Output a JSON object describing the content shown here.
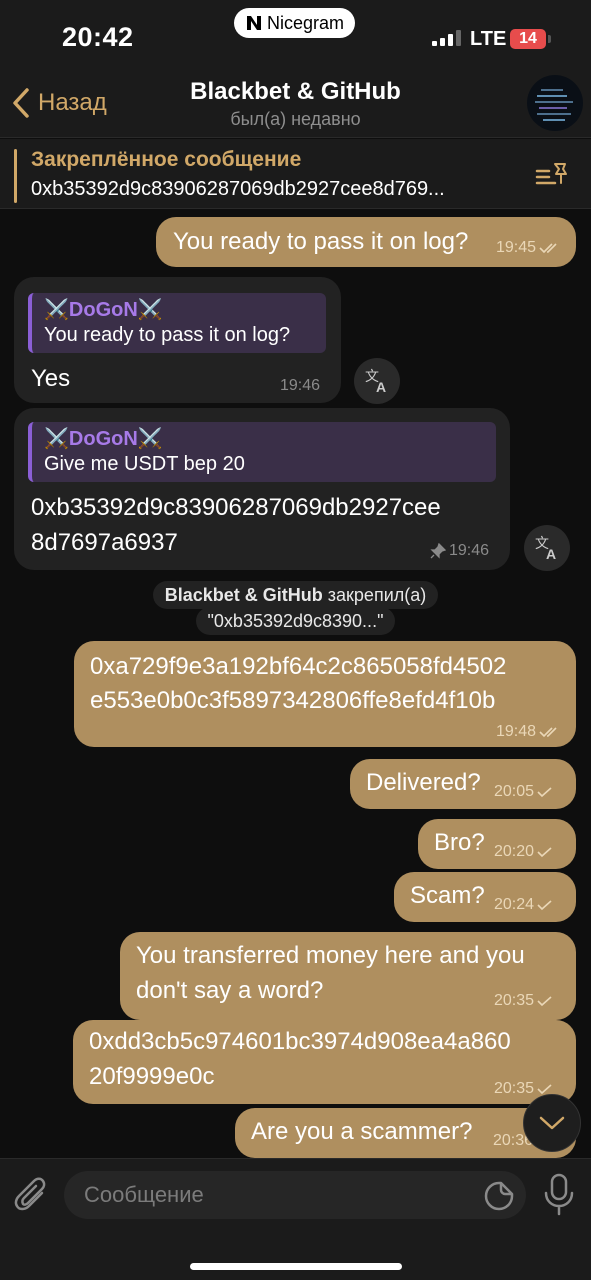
{
  "status_bar": {
    "time": "20:42",
    "app_pill": "Nicegram",
    "network": "LTE",
    "battery": "14"
  },
  "header": {
    "back_label": "Назад",
    "title": "Blackbet & GitHub",
    "subtitle": "был(а) недавно"
  },
  "pinned": {
    "title": "Закреплённое сообщение",
    "text": "0xb35392d9c83906287069db2927cee8d769..."
  },
  "messages": [
    {
      "text": "You ready to pass it on log?",
      "time": "19:45"
    },
    {
      "reply_name": "⚔️DoGoN⚔️",
      "reply_text": "You ready to pass it on log?",
      "text": "Yes",
      "time": "19:46"
    },
    {
      "reply_name": "⚔️DoGoN⚔️",
      "reply_text": "Give me USDT bep 20",
      "line1": "0xb35392d9c83906287069db2927cee",
      "line2": "8d7697a6937",
      "time": "19:46"
    },
    {
      "line1": "0xa729f9e3a192bf64c2c865058fd4502",
      "line2": "e553e0b0c3f5897342806ffe8efd4f10b",
      "time": "19:48"
    },
    {
      "text": "Delivered?",
      "time": "20:05"
    },
    {
      "text": "Bro?",
      "time": "20:20"
    },
    {
      "text": "Scam?",
      "time": "20:24"
    },
    {
      "line1": "You transferred money here and you",
      "line2": "don't say a word?",
      "time": "20:35"
    },
    {
      "line1": "0xdd3cb5c974601bc3974d908ea4a860",
      "line2": "20f9999e0c",
      "time": "20:35"
    },
    {
      "text": "Are you a scammer?",
      "time": "20:36"
    }
  ],
  "service": {
    "actor": "Blackbet & GitHub",
    "action": "закрепил(а)",
    "quote": "\"0xb35392d9c8390...\""
  },
  "translate_icon": "translate-icon",
  "input": {
    "placeholder": "Сообщение"
  },
  "colors": {
    "accent": "#d1a868",
    "outgoing_bubble": "#af8f5f",
    "incoming_bubble": "#222222",
    "reply_name": "#a77ae8"
  }
}
